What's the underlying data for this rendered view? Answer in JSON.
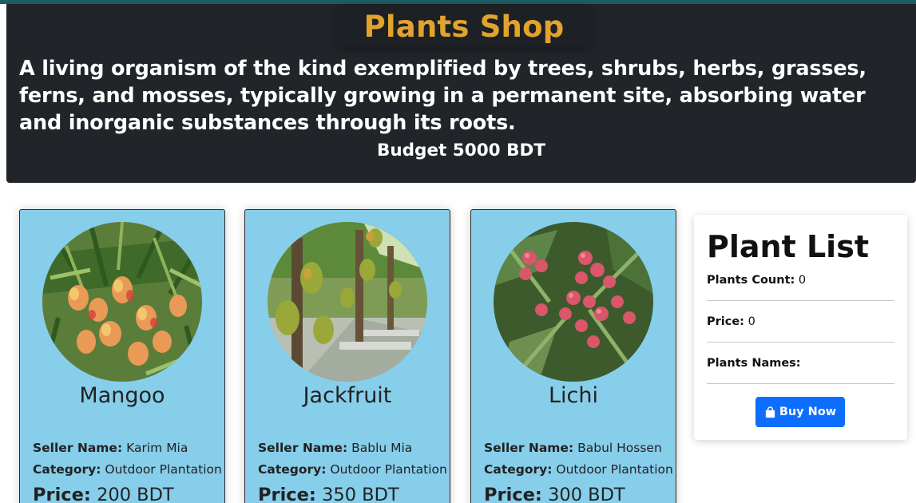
{
  "shop": {
    "title": "Plants Shop",
    "description": "A living organism of the kind exemplified by trees, shrubs, herbs, grasses, ferns, and mosses, typically growing in a permanent site, absorbing water and inorganic substances through its roots.",
    "budget": "Budget 5000 BDT"
  },
  "labels": {
    "seller": "Seller Name:",
    "category": "Category:",
    "price": "Price:"
  },
  "plants": [
    {
      "name": "Mangoo",
      "seller": "Karim Mia",
      "category": "Outdoor Plantation",
      "price": "200 BDT"
    },
    {
      "name": "Jackfruit",
      "seller": "Bablu Mia",
      "category": "Outdoor Plantation",
      "price": "350 BDT"
    },
    {
      "name": "Lichi",
      "seller": "Babul Hossen",
      "category": "Outdoor Plantation",
      "price": "300 BDT"
    }
  ],
  "plant_list": {
    "title": "Plant List",
    "count_label": "Plants Count:",
    "count_value": "0",
    "price_label": "Price:",
    "price_value": "0",
    "names_label": "Plants Names:",
    "buy_label": "Buy Now",
    "buy_icon": "shopping-bag-icon"
  },
  "colors": {
    "header_bg": "#212529",
    "title": "#e2a32d",
    "card_bg": "#87ceeb",
    "button": "#0d6efd"
  }
}
